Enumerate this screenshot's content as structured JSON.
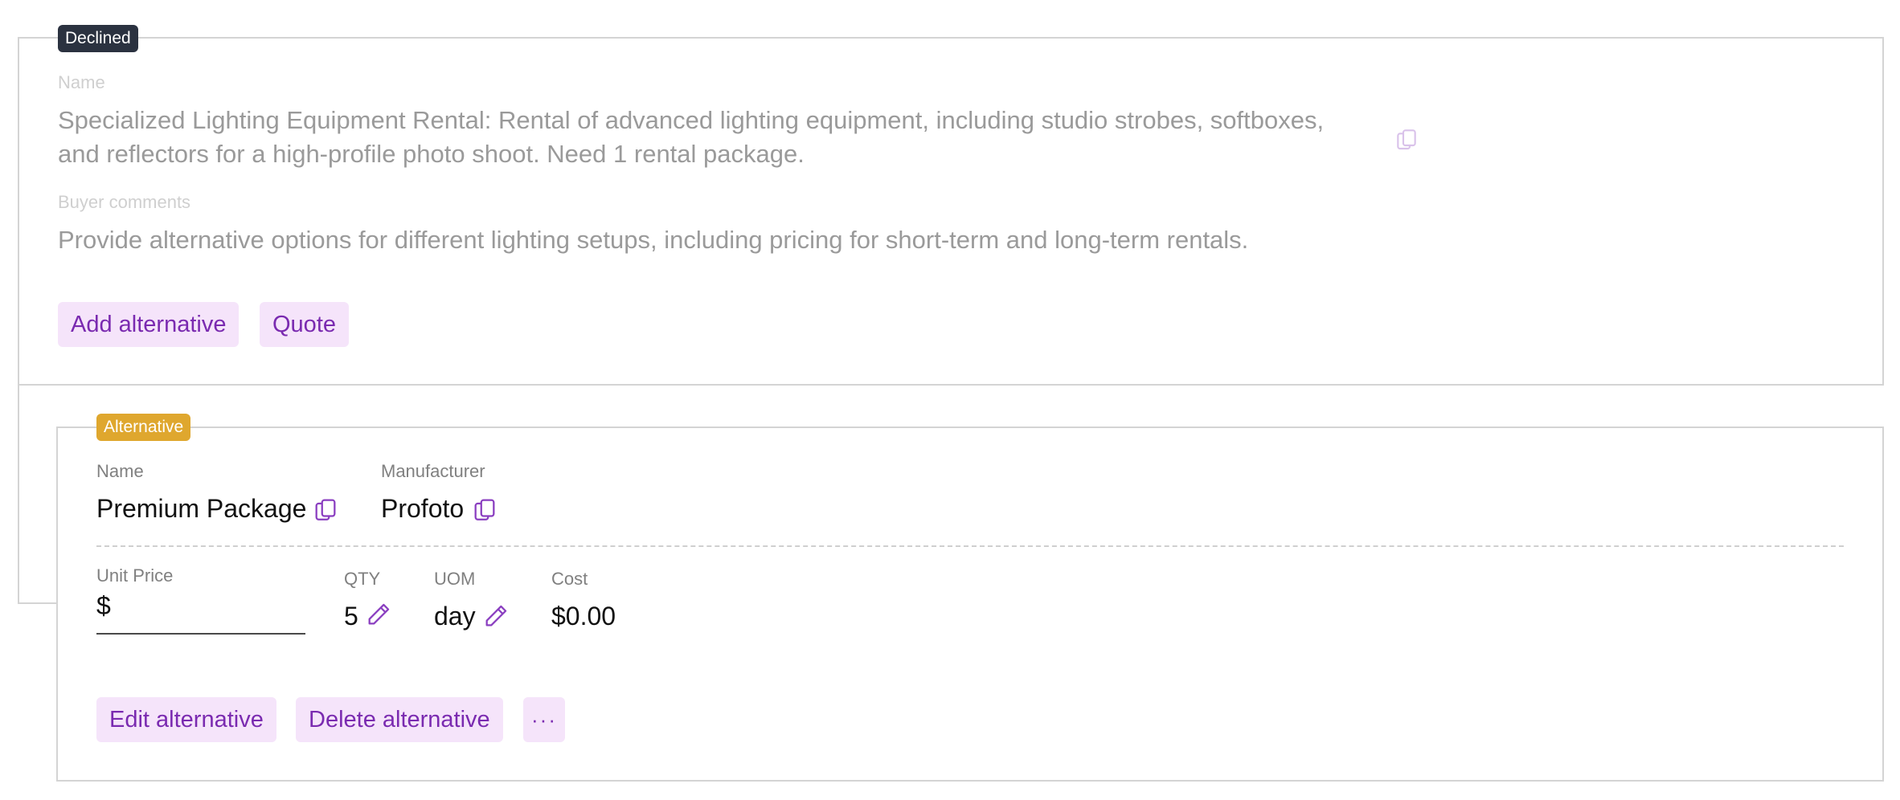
{
  "item": {
    "status_badge": "Declined",
    "name_label": "Name",
    "name_line1": "Specialized Lighting Equipment Rental: Rental of advanced lighting equipment, including studio strobes, softboxes,",
    "name_line2": "and reflectors for a high-profile photo shoot. Need 1 rental package.",
    "comments_label": "Buyer comments",
    "comments_text": "Provide alternative options for different lighting setups, including pricing for short-term and long-term rentals.",
    "add_alternative_label": "Add alternative",
    "quote_label": "Quote"
  },
  "alternative": {
    "badge": "Alternative",
    "name_label": "Name",
    "name_value": "Premium Package",
    "manufacturer_label": "Manufacturer",
    "manufacturer_value": "Profoto",
    "unit_price_label": "Unit Price",
    "unit_price_prefix": "$",
    "qty_label": "QTY",
    "qty_value": "5",
    "uom_label": "UOM",
    "uom_value": "day",
    "cost_label": "Cost",
    "cost_value": "$0.00",
    "edit_label": "Edit alternative",
    "delete_label": "Delete alternative",
    "more_label": "···"
  },
  "icons": {
    "copy": "copy-icon",
    "edit": "pencil-icon",
    "more": "more-horizontal-icon"
  },
  "colors": {
    "accent": "#7a2ab0",
    "button_bg": "#f5e4fa",
    "declined_badge": "#2b3240",
    "alternative_badge": "#dfa72e"
  }
}
